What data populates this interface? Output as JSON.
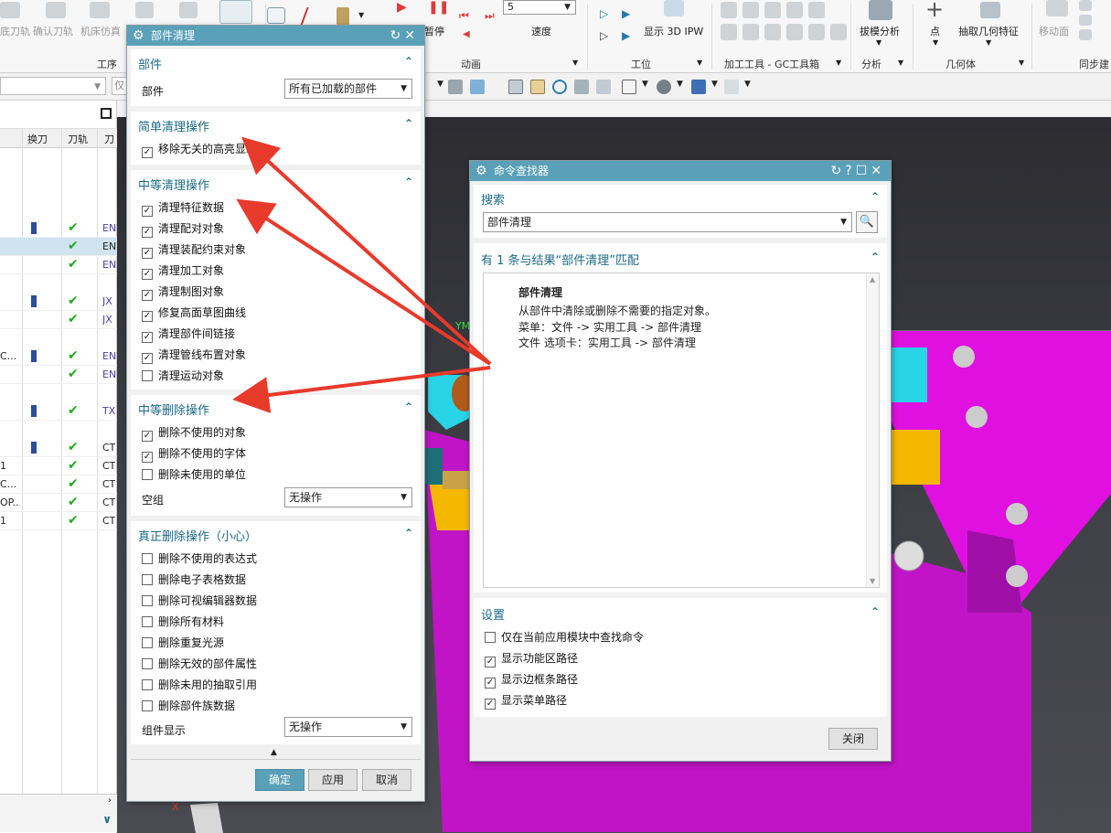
{
  "ribbon": {
    "top_labels": [
      "底刀轨",
      "确认刀轨",
      "机床仿真"
    ],
    "playback": {
      "pause_label": "暂停",
      "speed_value": "5",
      "speed_label": "速度"
    },
    "ipw_label": "显示 3D IPW",
    "draft_analysis": "拔模分析",
    "point": "点",
    "extract_geometry": "抽取几何特征",
    "move_face": "移动面",
    "groups": [
      "工序",
      "动画",
      "工位",
      "加工工具 - GC工具箱",
      "分析",
      "几何体",
      "同步建"
    ],
    "filter_placeholder": "仅"
  },
  "navigator": {
    "headers": [
      "换刀",
      "刀轨",
      "刀"
    ],
    "rows": [
      {
        "name": "",
        "tool": true,
        "check": true,
        "code": "EN"
      },
      {
        "name": "",
        "tool": false,
        "check": true,
        "code": "EN",
        "selected": true
      },
      {
        "name": "",
        "tool": false,
        "check": true,
        "code": "EN"
      },
      {
        "name": "",
        "tool": true,
        "check": true,
        "code": "JX"
      },
      {
        "name": "",
        "tool": false,
        "check": true,
        "code": "JX"
      },
      {
        "name": "C...",
        "tool": true,
        "check": true,
        "code": "EN"
      },
      {
        "name": "",
        "tool": false,
        "check": true,
        "code": "EN"
      },
      {
        "name": "",
        "tool": true,
        "check": true,
        "code": "TX"
      },
      {
        "name": "",
        "tool": true,
        "check": true,
        "code": "CT"
      },
      {
        "name": "1",
        "tool": false,
        "check": true,
        "code": "CT"
      },
      {
        "name": "C...",
        "tool": false,
        "check": true,
        "code": "CT"
      },
      {
        "name": "OP...",
        "tool": false,
        "check": true,
        "code": "CT"
      },
      {
        "name": "1",
        "tool": false,
        "check": true,
        "code": "CT"
      }
    ]
  },
  "viewport": {
    "axis_label": "YM",
    "axis_x": "X"
  },
  "part_cleanup": {
    "title": "部件清理",
    "part_section": {
      "header": "部件",
      "label": "部件",
      "value": "所有已加载的部件"
    },
    "simple": {
      "header": "简单清理操作",
      "items": [
        {
          "label": "移除无关的高亮显示",
          "checked": true
        }
      ]
    },
    "medium": {
      "header": "中等清理操作",
      "items": [
        {
          "label": "清理特征数据",
          "checked": true
        },
        {
          "label": "清理配对对象",
          "checked": true
        },
        {
          "label": "清理装配约束对象",
          "checked": true
        },
        {
          "label": "清理加工对象",
          "checked": true
        },
        {
          "label": "清理制图对象",
          "checked": true
        },
        {
          "label": "修复高面草图曲线",
          "checked": true
        },
        {
          "label": "清理部件间链接",
          "checked": true
        },
        {
          "label": "清理管线布置对象",
          "checked": true
        },
        {
          "label": "清理运动对象",
          "checked": false
        }
      ]
    },
    "medium_delete": {
      "header": "中等删除操作",
      "items": [
        {
          "label": "删除不使用的对象",
          "checked": true
        },
        {
          "label": "删除不使用的字体",
          "checked": true
        },
        {
          "label": "删除未使用的单位",
          "checked": false
        }
      ],
      "empty_group_label": "空组",
      "empty_group_value": "无操作"
    },
    "true_delete": {
      "header": "真正删除操作（小心）",
      "items": [
        {
          "label": "删除不使用的表达式",
          "checked": false
        },
        {
          "label": "删除电子表格数据",
          "checked": false
        },
        {
          "label": "删除可视编辑器数据",
          "checked": false
        },
        {
          "label": "删除所有材料",
          "checked": false
        },
        {
          "label": "删除重复光源",
          "checked": false
        },
        {
          "label": "删除无效的部件属性",
          "checked": false
        },
        {
          "label": "删除未用的抽取引用",
          "checked": false
        },
        {
          "label": "删除部件族数据",
          "checked": false
        }
      ],
      "component_display_label": "组件显示",
      "component_display_value": "无操作"
    },
    "buttons": {
      "ok": "确定",
      "apply": "应用",
      "cancel": "取消"
    }
  },
  "command_finder": {
    "title": "命令查找器",
    "search_header": "搜索",
    "search_value": "部件清理",
    "results_header": "有 1 条与结果“部件清理”匹配",
    "result": {
      "name": "部件清理",
      "description": "从部件中清除或删除不需要的指定对象。",
      "menu_path": "菜单：文件 -> 实用工具 -> 部件清理",
      "tab_path": "文件 选项卡：实用工具 -> 部件清理"
    },
    "settings_header": "设置",
    "settings": [
      {
        "label": "仅在当前应用模块中查找命令",
        "checked": false
      },
      {
        "label": "显示功能区路径",
        "checked": true
      },
      {
        "label": "显示边框条路径",
        "checked": true
      },
      {
        "label": "显示菜单路径",
        "checked": true
      }
    ],
    "close_label": "关闭"
  },
  "colors": {
    "accent": "#5aa0b9",
    "header_text": "#1b6a86",
    "arrow": "#e83a2b",
    "fixture": "#e010e0",
    "highlight": "#f5b800",
    "cyan": "#29d4e6"
  }
}
